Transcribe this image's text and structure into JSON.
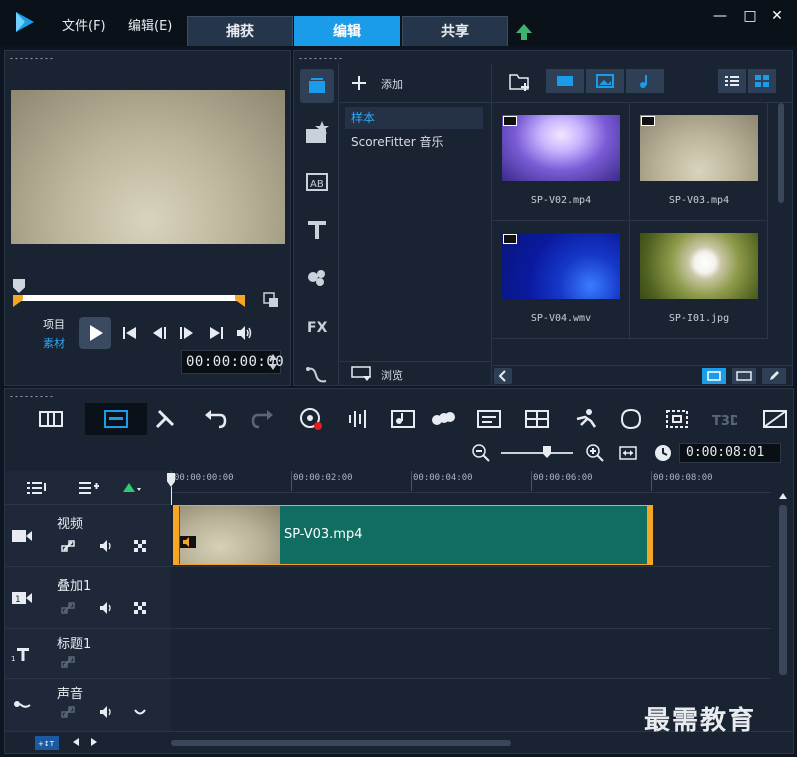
{
  "menu": {
    "file": "文件(F)",
    "edit": "编辑(E)"
  },
  "tabs": [
    {
      "label": "捕获"
    },
    {
      "label": "编辑"
    },
    {
      "label": "共享"
    }
  ],
  "colors": {
    "accent": "#1b9ce8",
    "clip": "#0f6e61",
    "marker": "#f5a623"
  },
  "player": {
    "mode_project": "项目",
    "mode_clip": "素材",
    "timecode": "00:00:00:00"
  },
  "library": {
    "add_label": "添加",
    "folders": [
      {
        "label": "样本"
      },
      {
        "label": "ScoreFitter 音乐"
      }
    ],
    "browse_label": "浏览",
    "media": [
      {
        "name": "SP-V02.mp4"
      },
      {
        "name": "SP-V03.mp4"
      },
      {
        "name": "SP-V04.wmv"
      },
      {
        "name": "SP-I01.jpg"
      }
    ]
  },
  "timeline": {
    "duration": "0:00:08:01",
    "ruler": [
      "00:00:00:00",
      "00:00:02:00",
      "00:00:04:00",
      "00:00:06:00",
      "00:00:08:00"
    ],
    "tracks": [
      {
        "name": "视频"
      },
      {
        "name": "叠加1"
      },
      {
        "name": "标题1"
      },
      {
        "name": "声音"
      }
    ],
    "clip_name": "SP-V03.mp4"
  },
  "watermark": "最需教育"
}
